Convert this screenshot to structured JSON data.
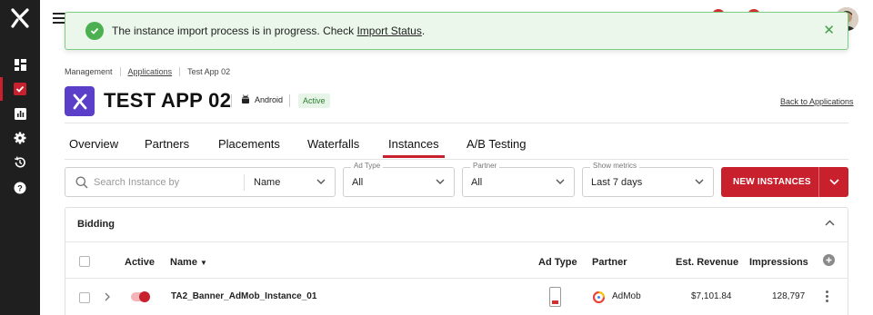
{
  "sidebar": {
    "logo": "x-logo",
    "items": [
      {
        "icon": "dashboard-icon",
        "active": false
      },
      {
        "icon": "applications-icon",
        "active": true
      },
      {
        "icon": "reports-icon",
        "active": false
      },
      {
        "icon": "settings-gear-icon",
        "active": false
      },
      {
        "icon": "history-icon",
        "active": false
      },
      {
        "icon": "help-icon",
        "active": false
      }
    ]
  },
  "toast": {
    "message": "The instance import process is in progress. Check ",
    "link": "Import Status",
    "suffix": "."
  },
  "breadcrumb": {
    "items": [
      "Management",
      "Applications",
      "Test App 02"
    ]
  },
  "app": {
    "title": "TEST APP 02",
    "platform": "Android",
    "status": "Active",
    "back_link": "Back to Applications"
  },
  "tabs": [
    "Overview",
    "Partners",
    "Placements",
    "Waterfalls",
    "Instances",
    "A/B Testing"
  ],
  "active_tab": "Instances",
  "filters": {
    "search_placeholder": "Search Instance by",
    "search_by": "Name",
    "ad_type": {
      "label": "Ad Type",
      "value": "All"
    },
    "partner": {
      "label": "Partner",
      "value": "All"
    },
    "metrics": {
      "label": "Show metrics",
      "value": "Last 7 days"
    }
  },
  "actions": {
    "new_instances": "NEW INSTANCES"
  },
  "table": {
    "section": "Bidding",
    "columns": {
      "active": "Active",
      "name": "Name",
      "ad_type": "Ad Type",
      "partner": "Partner",
      "revenue": "Est. Revenue",
      "impressions": "Impressions"
    },
    "rows": [
      {
        "active": true,
        "name": "TA2_Banner_AdMob_Instance_01",
        "ad_type": "banner",
        "partner": "AdMob",
        "revenue": "$7,101.84",
        "impressions": "128,797"
      }
    ]
  },
  "colors": {
    "accent": "#c8202d",
    "success": "#4caf50",
    "app_logo": "#5b3fc8"
  }
}
